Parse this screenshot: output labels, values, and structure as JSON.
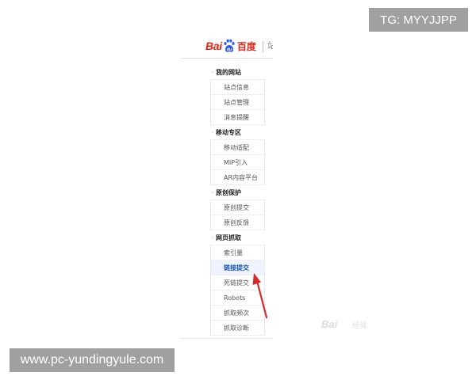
{
  "overlays": {
    "top_tag": "TG: MYYJJPP",
    "bottom_url": "www.pc-yundingyule.com"
  },
  "header": {
    "logo_bai": "Bai",
    "logo_du": "du",
    "logo_cn": "百度",
    "cut_text": "站"
  },
  "menu": {
    "sections": [
      {
        "label": "我的网站",
        "items": [
          "站点信息",
          "站点管理",
          "消息提醒"
        ]
      },
      {
        "label": "移动专区",
        "items": [
          "移动适配",
          "MIP引入",
          "AR内容平台"
        ]
      },
      {
        "label": "原创保护",
        "items": [
          "原创提交",
          "原创反馈"
        ]
      },
      {
        "label": "网页抓取",
        "items": [
          "索引量",
          "链接提交",
          "死链提交",
          "Robots",
          "抓取频次",
          "抓取诊断"
        ]
      }
    ],
    "active_item": "链接提交"
  },
  "watermark": {
    "text": "Bai",
    "sub": "经验"
  },
  "colors": {
    "brand_red": "#e1251b",
    "brand_blue": "#2f5fd8",
    "arrow": "#d42a2a",
    "active_link": "#1a56b0"
  }
}
